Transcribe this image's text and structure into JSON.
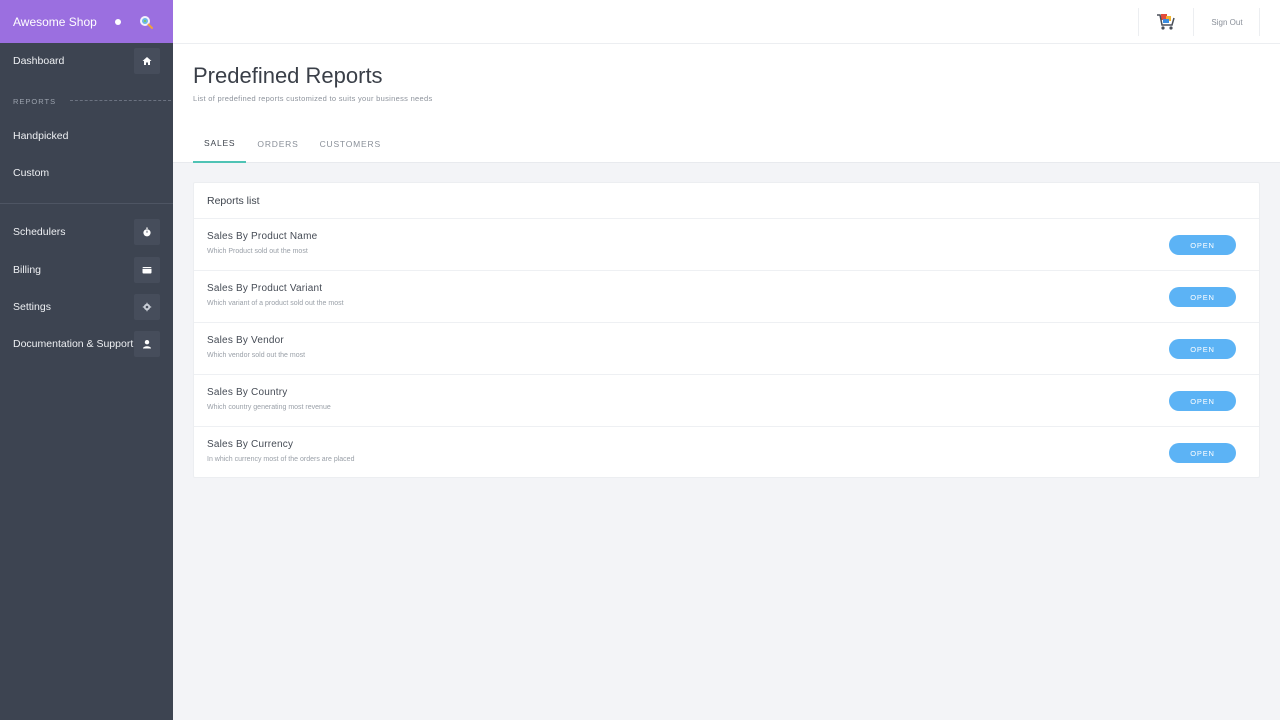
{
  "sidebar": {
    "brand": "Awesome Shop",
    "section_label": "REPORTS",
    "items": {
      "dashboard": "Dashboard",
      "handpicked": "Handpicked",
      "custom": "Custom",
      "schedulers": "Schedulers",
      "billing": "Billing",
      "settings": "Settings",
      "docs": "Documentation & Support"
    }
  },
  "topbar": {
    "signout_label": "Sign Out"
  },
  "header": {
    "title": "Predefined Reports",
    "subtitle": "List of predefined reports customized to suits your business needs",
    "tabs": [
      "SALES",
      "ORDERS",
      "CUSTOMERS"
    ],
    "active_tab": "SALES"
  },
  "reports": {
    "title": "Reports list",
    "button_label": "OPEN",
    "items": [
      {
        "title": "Sales By Product Name",
        "desc": "Which Product sold out the most"
      },
      {
        "title": "Sales By Product Variant",
        "desc": "Which variant of a product sold out the most"
      },
      {
        "title": "Sales By Vendor",
        "desc": "Which vendor sold out the most"
      },
      {
        "title": "Sales By Country",
        "desc": "Which country generating most revenue"
      },
      {
        "title": "Sales By Currency",
        "desc": "In which currency most of the orders are placed"
      }
    ]
  },
  "colors": {
    "brand": "#9b6fe0",
    "sidebar": "#3d4451",
    "accent_tab": "#4fc3b5",
    "button": "#5cb3f5"
  }
}
